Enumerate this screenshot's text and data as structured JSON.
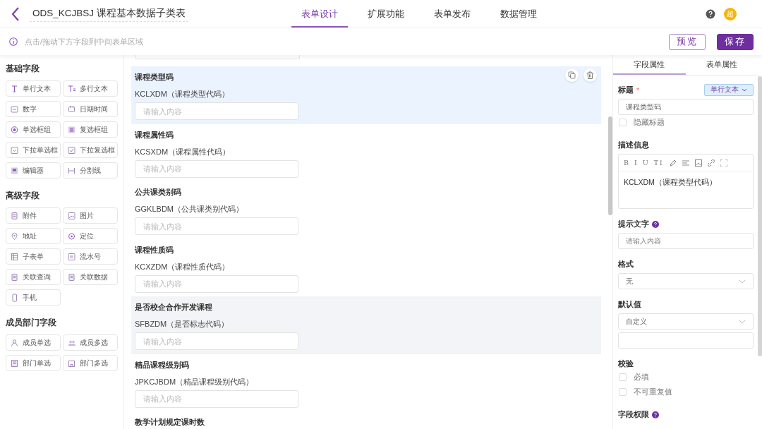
{
  "header": {
    "title": "ODS_KCJBSJ 课程基本数据子类表",
    "tabs": [
      {
        "label": "表单设计",
        "selected": true
      },
      {
        "label": "扩展功能",
        "selected": false
      },
      {
        "label": "表单发布",
        "selected": false
      },
      {
        "label": "数据管理",
        "selected": false
      }
    ],
    "avatar": "超"
  },
  "toolbar": {
    "hint": "点击/拖动下方字段到中间表单区域",
    "buttons": [
      {
        "label": "预览",
        "kind": "outline"
      },
      {
        "label": "保存",
        "kind": "primary"
      }
    ]
  },
  "palette": [
    {
      "heading": "基础字段",
      "items": [
        "单行文本",
        "多行文本",
        "数字",
        "日期时间",
        "单选框组",
        "复选框组",
        "下拉单选框",
        "下拉复选框",
        "编辑器",
        "分割线"
      ]
    },
    {
      "heading": "高级字段",
      "items": [
        "附件",
        "图片",
        "地址",
        "定位",
        "子表单",
        "流水号",
        "关联查询",
        "关联数据",
        "手机"
      ]
    },
    {
      "heading": "成员部门字段",
      "items": [
        "成员单选",
        "成员多选",
        "部门单选",
        "部门多选"
      ]
    }
  ],
  "canvas": {
    "fields": [
      {
        "title": "课程类型码",
        "code": "KCLXDM（课程类型代码）",
        "placeholder": "请输入内容",
        "selected": true,
        "hovered": false
      },
      {
        "title": "课程属性码",
        "code": "KCSXDM（课程属性代码）",
        "placeholder": "请输入内容",
        "selected": false,
        "hovered": false
      },
      {
        "title": "公共课类别码",
        "code": "GGKLBDM（公共课类别代码）",
        "placeholder": "请输入内容",
        "selected": false,
        "hovered": false
      },
      {
        "title": "课程性质码",
        "code": "KCXZDM（课程性质代码）",
        "placeholder": "请输入内容",
        "selected": false,
        "hovered": false
      },
      {
        "title": "是否校企合作开发课程",
        "code": "SFBZDM（是否标志代码）",
        "placeholder": "请输入内容",
        "selected": false,
        "hovered": true
      },
      {
        "title": "精品课程级别码",
        "code": "JPKCJBDM（精品课程级别代码）",
        "placeholder": "请输入内容",
        "selected": false,
        "hovered": false
      },
      {
        "title": "教学计划规定课时数",
        "selected": false,
        "hovered": false
      }
    ]
  },
  "properties": {
    "tabs": [
      {
        "label": "字段属性",
        "selected": true
      },
      {
        "label": "表单属性",
        "selected": false
      }
    ],
    "title_label": "标题",
    "required_mark": "*",
    "type_tag": "单行文本",
    "title_value": "课程类型码",
    "hide_title": {
      "label": "隐藏标题",
      "checked": false
    },
    "description_label": "描述信息",
    "editor_tools": [
      "B",
      "I",
      "U",
      "T↕"
    ],
    "description": "KCLXDM（课程类型代码）",
    "hint_label": "提示文字",
    "hint_placeholder": "请输入内容",
    "format_label": "格式",
    "format_value": "无",
    "default_label": "默认值",
    "default_value": "自定义",
    "validation_label": "校验",
    "validations": [
      {
        "label": "必填",
        "checked": false
      },
      {
        "label": "不可重复值",
        "checked": false
      }
    ],
    "permission_label": "字段权限"
  }
}
